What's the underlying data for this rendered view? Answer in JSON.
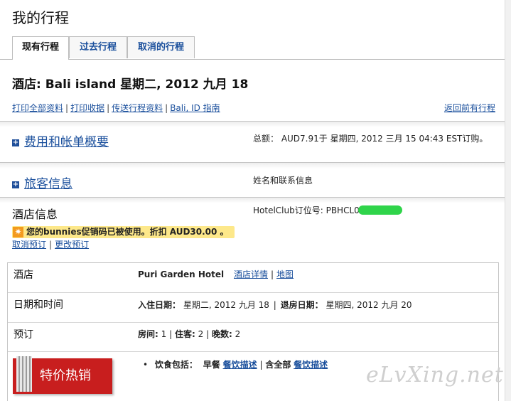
{
  "page": {
    "title": "我的行程"
  },
  "tabs": [
    {
      "label": "现有行程",
      "active": true
    },
    {
      "label": "过去行程",
      "active": false
    },
    {
      "label": "取消的行程",
      "active": false
    }
  ],
  "hotel_header": {
    "title": "酒店: Bali island 星期二, 2012 九月 18",
    "links": [
      "打印全部资料",
      "打印收据",
      "传送行程资料",
      "Bali, ID 指南"
    ],
    "back_link": "返回前有行程"
  },
  "sections": {
    "cost": {
      "title": "费用和帐单概要",
      "summary": "总额： AUD7.91于 星期四, 2012 三月 15 04:43 EST订购。"
    },
    "traveler": {
      "title": "旅客信息",
      "summary": "姓名和联系信息"
    }
  },
  "hotel_info": {
    "title": "酒店信息",
    "order_label": "HotelClub订位号: PBHCL0",
    "promo": "您的bunnies促销码已被使用。折扣 AUD30.00 。",
    "cancel_link": "取消预订",
    "change_link": "更改预订"
  },
  "table": {
    "hotel": {
      "label": "酒店",
      "name": "Puri Garden Hotel",
      "detail_link": "酒店详情",
      "map_link": "地图"
    },
    "dates": {
      "label": "日期和时间",
      "checkin_label": "入住日期：",
      "checkin": "星期二, 2012 九月 18",
      "checkout_label": "退房日期：",
      "checkout": "星期四, 2012 九月 20"
    },
    "booking": {
      "label": "预订",
      "rooms_label": "房间:",
      "rooms": "1",
      "guests_label": "住客:",
      "guests": "2",
      "nights_label": "晚数:",
      "nights": "2"
    },
    "meals": {
      "label": "饮食包括：",
      "breakfast": "早餐",
      "link1": "餐饮描述",
      "all": "含全部",
      "link2": "餐饮描述"
    },
    "sale_badge": "特价热销"
  },
  "watermark": "eLvXing.net"
}
